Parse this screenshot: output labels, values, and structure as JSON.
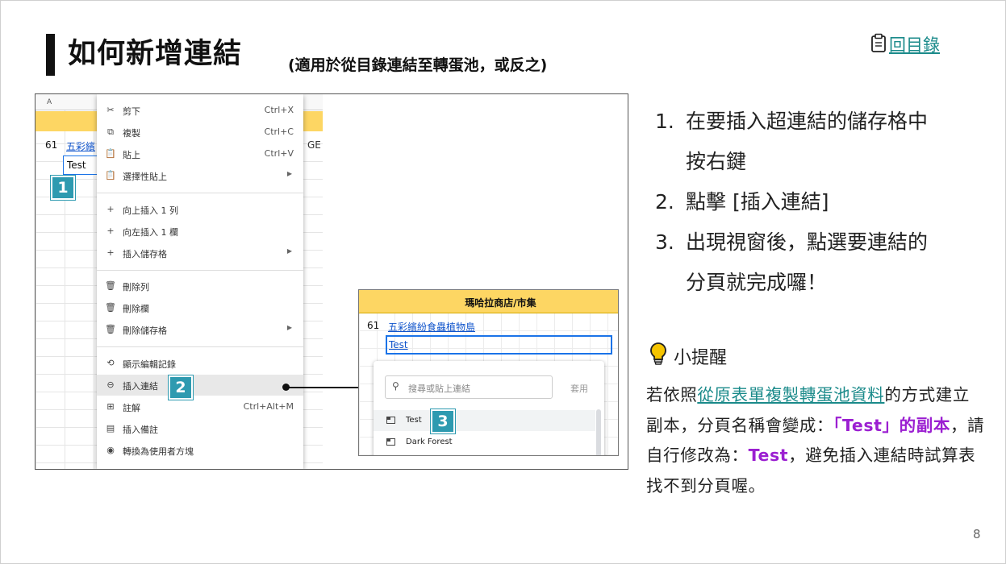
{
  "title": "如何新增連結",
  "subtitle": "(適用於從目錄連結至轉蛋池，或反之)",
  "toc_link": "回目錄",
  "sheet": {
    "col_header": "A",
    "row_num": "61",
    "row_link": "五彩繽",
    "cell_value": "Test",
    "overflow_text": "GE"
  },
  "badges": [
    "1",
    "2",
    "3"
  ],
  "menu": {
    "items": [
      {
        "icon": "✂",
        "label": "剪下",
        "shortcut": "Ctrl+X"
      },
      {
        "icon": "⧉",
        "label": "複製",
        "shortcut": "Ctrl+C"
      },
      {
        "icon": "📋",
        "label": "貼上",
        "shortcut": "Ctrl+V"
      },
      {
        "icon": "📋",
        "label": "選擇性貼上",
        "arrow": "▶"
      },
      {
        "icon": "+",
        "label": "向上插入 1 列"
      },
      {
        "icon": "+",
        "label": "向左插入 1 欄"
      },
      {
        "icon": "+",
        "label": "插入儲存格",
        "arrow": "▶"
      },
      {
        "icon": "🗑",
        "label": "刪除列"
      },
      {
        "icon": "🗑",
        "label": "刪除欄"
      },
      {
        "icon": "🗑",
        "label": "刪除儲存格",
        "arrow": "▶"
      },
      {
        "icon": "⟲",
        "label": "顯示編輯記錄"
      },
      {
        "icon": "⊖",
        "label": "插入連結"
      },
      {
        "icon": "⊞",
        "label": "註解",
        "shortcut": "Ctrl+Alt+M"
      },
      {
        "icon": "▤",
        "label": "插入備註"
      },
      {
        "icon": "◉",
        "label": "轉換為使用者方塊"
      }
    ]
  },
  "inset": {
    "header": "瑪哈拉商店/市集",
    "row_num": "61",
    "row_link": "五彩繽紛食蟲植物島",
    "cell_link": "Test",
    "search_placeholder": "搜尋或貼上連結",
    "apply_label": "套用",
    "options": [
      "Test",
      "Dark Forest"
    ]
  },
  "steps": [
    {
      "num": "1.",
      "line1": "在要插入超連結的儲存格中",
      "line2": "按右鍵"
    },
    {
      "num": "2.",
      "line1": "點擊 [插入連結]"
    },
    {
      "num": "3.",
      "line1": "出現視窗後，點選要連結的",
      "line2": "分頁就完成囉！"
    }
  ],
  "tip": {
    "title": "小提醒",
    "p1": "若依照",
    "link": "從原表單複製轉蛋池資料",
    "p2": "的方式建立副本，分頁名稱會變成：",
    "em1": "「Test」的副本",
    "p3": "，請自行修改為：",
    "em2": "Test",
    "p4": "，避免插入連結時試算表找不到分頁喔。"
  },
  "page_number": "8",
  "colors": {
    "accent": "#1a8a8a",
    "badge": "#2e9ab0",
    "highlight": "#9b1fd1",
    "sheet_header": "#fdd663"
  }
}
